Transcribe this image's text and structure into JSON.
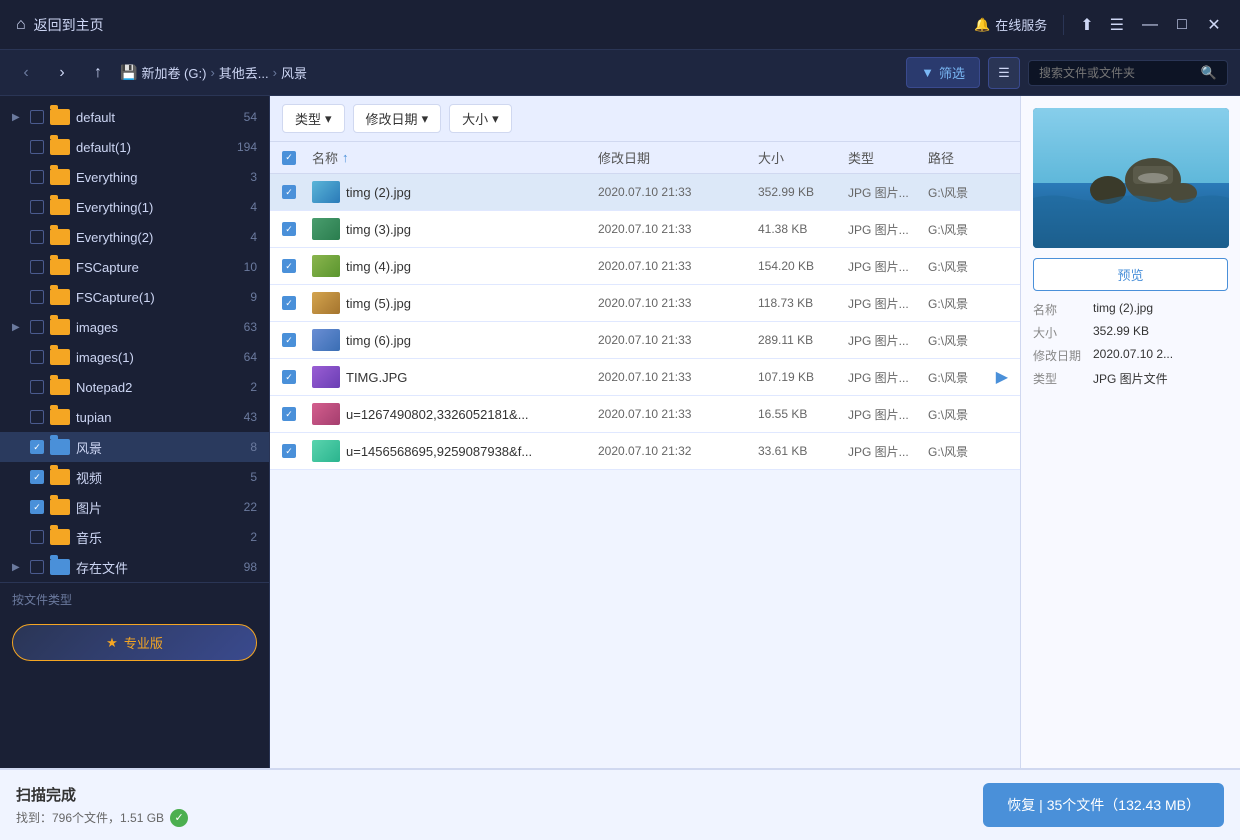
{
  "titleBar": {
    "homeLabel": "返回到主页",
    "onlineService": "在线服务",
    "windowControls": {
      "minimize": "—",
      "maximize": "□",
      "close": "✕"
    }
  },
  "navBar": {
    "breadcrumb": {
      "drive": "新加卷 (G:)",
      "folder1": "其他丢...",
      "folder2": "风景"
    },
    "filterBtn": "筛选",
    "searchPlaceholder": "搜索文件或文件夹"
  },
  "filterBar": {
    "tags": [
      {
        "label": "类型",
        "suffix": "▾"
      },
      {
        "label": "修改日期",
        "suffix": "▾"
      },
      {
        "label": "大小",
        "suffix": "▾"
      }
    ]
  },
  "tableHeader": {
    "name": "名称",
    "sortIcon": "↑",
    "date": "修改日期",
    "size": "大小",
    "type": "类型",
    "path": "路径"
  },
  "files": [
    {
      "name": "timg (2).jpg",
      "date": "2020.07.10 21:33",
      "size": "352.99 KB",
      "type": "JPG 图片...",
      "path": "G:\\风景",
      "selected": true
    },
    {
      "name": "timg (3).jpg",
      "date": "2020.07.10 21:33",
      "size": "41.38 KB",
      "type": "JPG 图片...",
      "path": "G:\\风景",
      "selected": true
    },
    {
      "name": "timg (4).jpg",
      "date": "2020.07.10 21:33",
      "size": "154.20 KB",
      "type": "JPG 图片...",
      "path": "G:\\风景",
      "selected": true
    },
    {
      "name": "timg (5).jpg",
      "date": "2020.07.10 21:33",
      "size": "118.73 KB",
      "type": "JPG 图片...",
      "path": "G:\\风景",
      "selected": true
    },
    {
      "name": "timg (6).jpg",
      "date": "2020.07.10 21:33",
      "size": "289.11 KB",
      "type": "JPG 图片...",
      "path": "G:\\风景",
      "selected": true
    },
    {
      "name": "TIMG.JPG",
      "date": "2020.07.10 21:33",
      "size": "107.19 KB",
      "type": "JPG 图片...",
      "path": "G:\\风景",
      "selected": true
    },
    {
      "name": "u=1267490802,3326052181&...",
      "date": "2020.07.10 21:33",
      "size": "16.55 KB",
      "type": "JPG 图片...",
      "path": "G:\\风景",
      "selected": true
    },
    {
      "name": "u=1456568695,9259087938&f...",
      "date": "2020.07.10 21:32",
      "size": "33.61 KB",
      "type": "JPG 图片...",
      "path": "G:\\风景",
      "selected": true
    }
  ],
  "sidebar": {
    "items": [
      {
        "name": "default",
        "count": "54",
        "checked": false,
        "expanded": true
      },
      {
        "name": "default(1)",
        "count": "194",
        "checked": false,
        "expanded": false
      },
      {
        "name": "Everything",
        "count": "3",
        "checked": false,
        "expanded": false
      },
      {
        "name": "Everything(1)",
        "count": "4",
        "checked": false,
        "expanded": false
      },
      {
        "name": "Everything(2)",
        "count": "4",
        "checked": false,
        "expanded": false
      },
      {
        "name": "FSCapture",
        "count": "10",
        "checked": false,
        "expanded": false
      },
      {
        "name": "FSCapture(1)",
        "count": "9",
        "checked": false,
        "expanded": false
      },
      {
        "name": "images",
        "count": "63",
        "checked": false,
        "expanded": true
      },
      {
        "name": "images(1)",
        "count": "64",
        "checked": false,
        "expanded": false
      },
      {
        "name": "Notepad2",
        "count": "2",
        "checked": false,
        "expanded": false
      },
      {
        "name": "tupian",
        "count": "43",
        "checked": false,
        "expanded": false
      },
      {
        "name": "风景",
        "count": "8",
        "checked": true,
        "expanded": false,
        "selected": true
      },
      {
        "name": "视频",
        "count": "5",
        "checked": true,
        "expanded": false
      },
      {
        "name": "图片",
        "count": "22",
        "checked": true,
        "expanded": false
      },
      {
        "name": "音乐",
        "count": "2",
        "checked": false,
        "expanded": false
      },
      {
        "name": "存在文件",
        "count": "98",
        "checked": false,
        "expanded": true
      }
    ],
    "footerLabel": "按文件类型",
    "proBtn": "专业版"
  },
  "preview": {
    "btnLabel": "预览",
    "fileInfo": {
      "nameLabel": "名称",
      "nameValue": "timg (2).jpg",
      "sizeLabel": "大小",
      "sizeValue": "352.99 KB",
      "dateLabel": "修改日期",
      "dateValue": "2020.07.10 2...",
      "typeLabel": "类型",
      "typeValue": "JPG 图片文件"
    }
  },
  "bottomBar": {
    "title": "扫描完成",
    "subtitle": "找到：796个文件，1.51 GB",
    "restoreBtn": "恢复 | 35个文件（132.43 MB）"
  }
}
